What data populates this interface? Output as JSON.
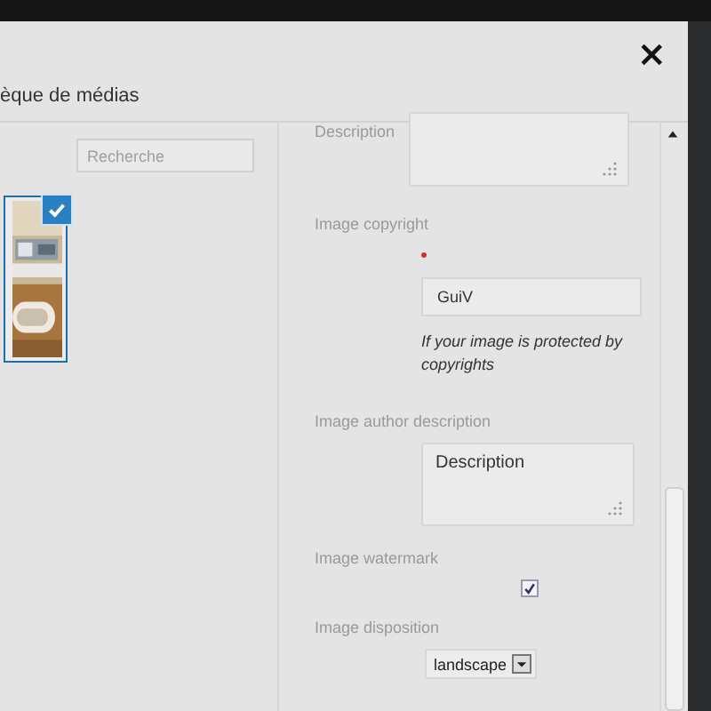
{
  "modal": {
    "title": "èque de médias",
    "close": "×"
  },
  "library": {
    "search": {
      "placeholder": "Recherche"
    },
    "items": [
      {
        "kind": "picture",
        "selected": true
      }
    ]
  },
  "details": {
    "fields": [
      {
        "kind": "textarea",
        "label": "Description"
      },
      {
        "kind": "text",
        "label": "Image copyright",
        "required": true,
        "value": "GuiV",
        "help": "If your image is protected by copyrights"
      },
      {
        "kind": "textarea",
        "label": "Image author description",
        "value": "Description"
      },
      {
        "kind": "checkbox",
        "label": "Image watermark",
        "checked": true
      },
      {
        "kind": "select",
        "label": "Image disposition",
        "value": "landscape"
      }
    ]
  }
}
